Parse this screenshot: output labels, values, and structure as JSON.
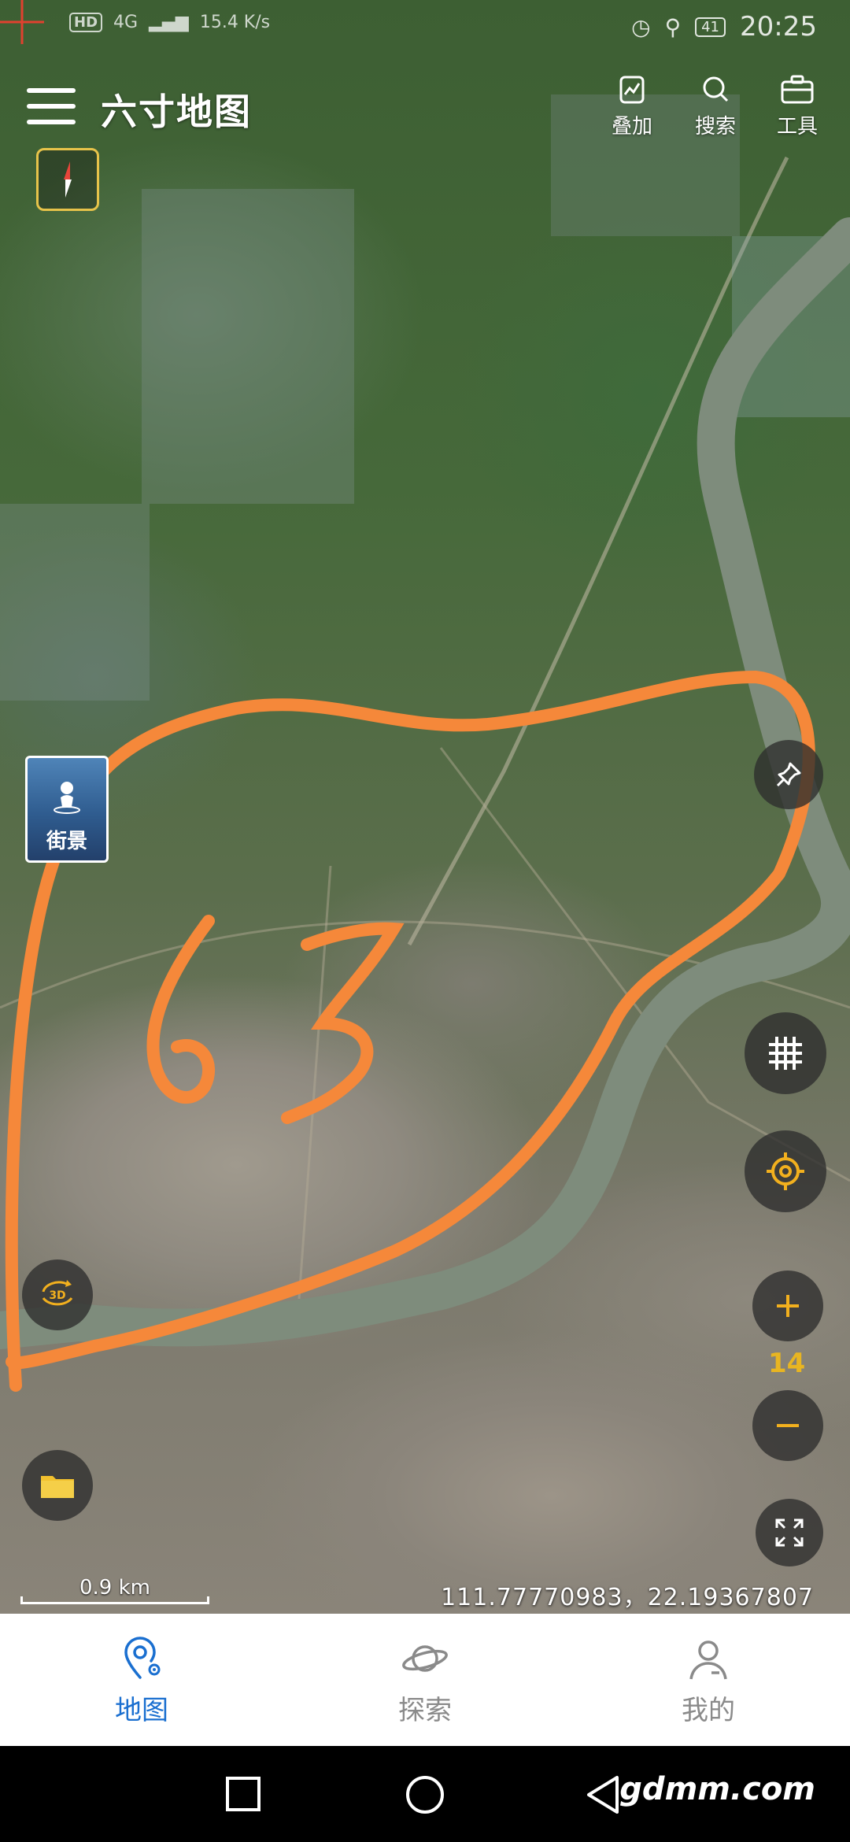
{
  "status_bar": {
    "network": "4G",
    "speed": "15.4 K/s",
    "hd": "HD",
    "battery": "41",
    "time": "20:25"
  },
  "header": {
    "title": "六寸地图"
  },
  "toolbar": {
    "overlay_label": "叠加",
    "search_label": "搜索",
    "tools_label": "工具"
  },
  "map": {
    "street_view_label": "街景",
    "zoom_level": "14",
    "scale_label": "0.9 km",
    "coordinates": "111.77770983，22.19367807",
    "annotation_text": "63",
    "annotation_color": "#f5883a",
    "river_color": "#7e8c7c"
  },
  "icons": {
    "compass": "compass-icon",
    "pin": "pin-icon",
    "grid": "grid-icon",
    "locate": "locate-icon",
    "zoom_in": "plus-icon",
    "zoom_out": "minus-icon",
    "fullscreen": "fullscreen-icon",
    "mode3d": "3d-rotate-icon",
    "folder": "folder-icon"
  },
  "bottom_nav": {
    "items": [
      {
        "label": "地图",
        "active": true
      },
      {
        "label": "探索",
        "active": false
      },
      {
        "label": "我的",
        "active": false
      }
    ]
  },
  "system_nav": {
    "watermark": "gdmm.com"
  }
}
